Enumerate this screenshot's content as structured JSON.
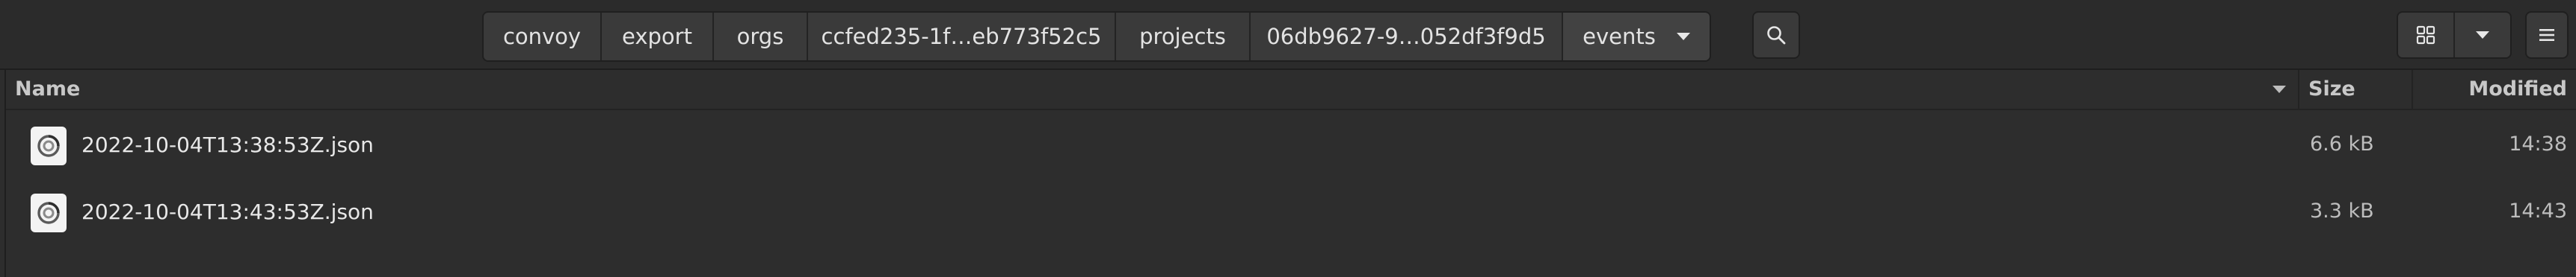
{
  "path_bar": {
    "segments": [
      "convoy",
      "export",
      "orgs",
      "ccfed235-1f…eb773f52c5",
      "projects",
      "06db9627-9…052df3f9d5",
      "events"
    ]
  },
  "toolbar": {
    "search_icon": "search-icon",
    "view_icon": "grid-view-icon",
    "view_options_icon": "chevron-down-icon",
    "menu_icon": "hamburger-menu-icon"
  },
  "columns": {
    "name": "Name",
    "size": "Size",
    "modified": "Modified"
  },
  "files": [
    {
      "name": "2022-10-04T13:38:53Z.json",
      "size": "6.6 kB",
      "modified": "14:38"
    },
    {
      "name": "2022-10-04T13:43:53Z.json",
      "size": "3.3 kB",
      "modified": "14:43"
    }
  ]
}
